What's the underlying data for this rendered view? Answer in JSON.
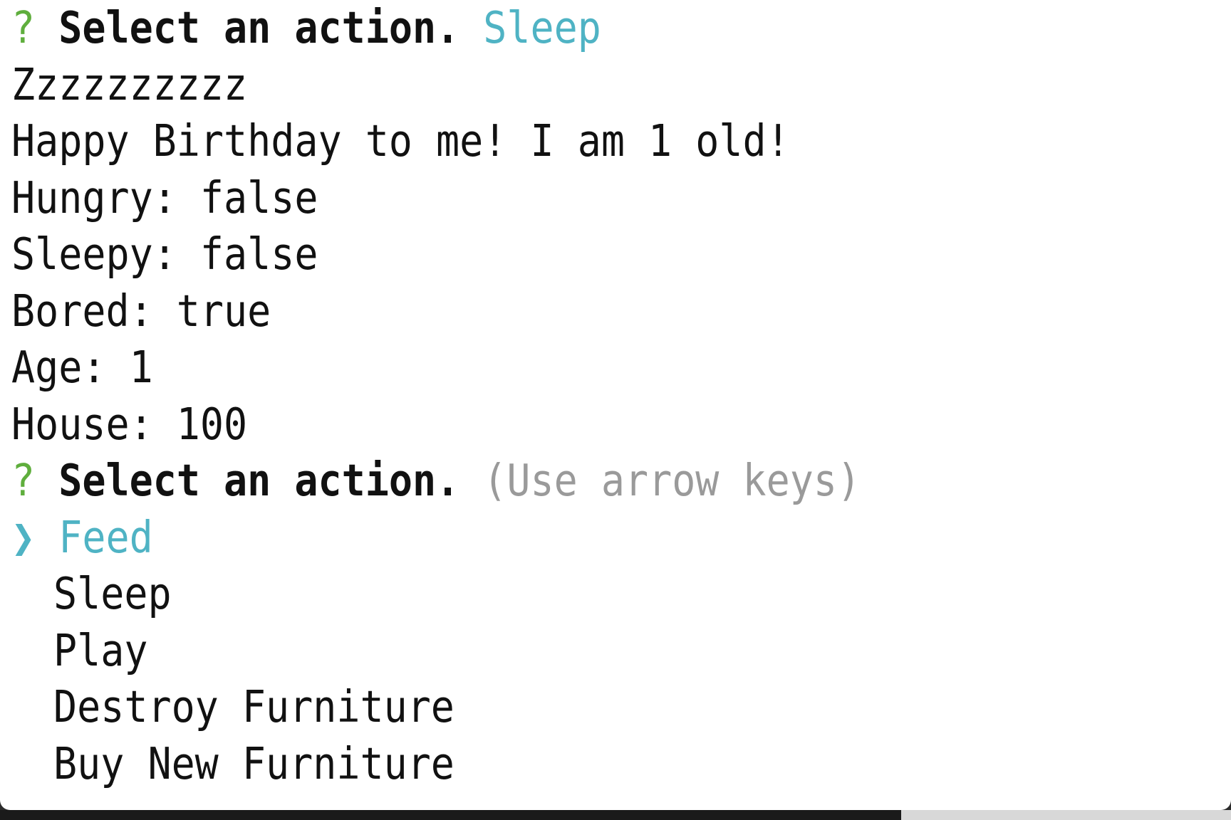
{
  "history": {
    "prompt_symbol": "?",
    "prompt_label": "Select an action.",
    "answer": "Sleep",
    "output_lines": [
      "Zzzzzzzzzz",
      "Happy Birthday to me! I am 1 old!",
      "Hungry: false",
      "Sleepy: false",
      "Bored: true",
      "Age: 1",
      "House: 100"
    ]
  },
  "current_prompt": {
    "prompt_symbol": "?",
    "prompt_label": "Select an action.",
    "hint": "(Use arrow keys)",
    "pointer": "❯",
    "selected_index": 0,
    "options": [
      "Feed",
      "Sleep",
      "Play",
      "Destroy Furniture",
      "Buy New Furniture"
    ]
  },
  "colors": {
    "prompt_symbol": "#5fae3d",
    "accent": "#4fb3c4",
    "hint": "#9a9a9a",
    "text": "#111111",
    "background": "#ffffff"
  }
}
